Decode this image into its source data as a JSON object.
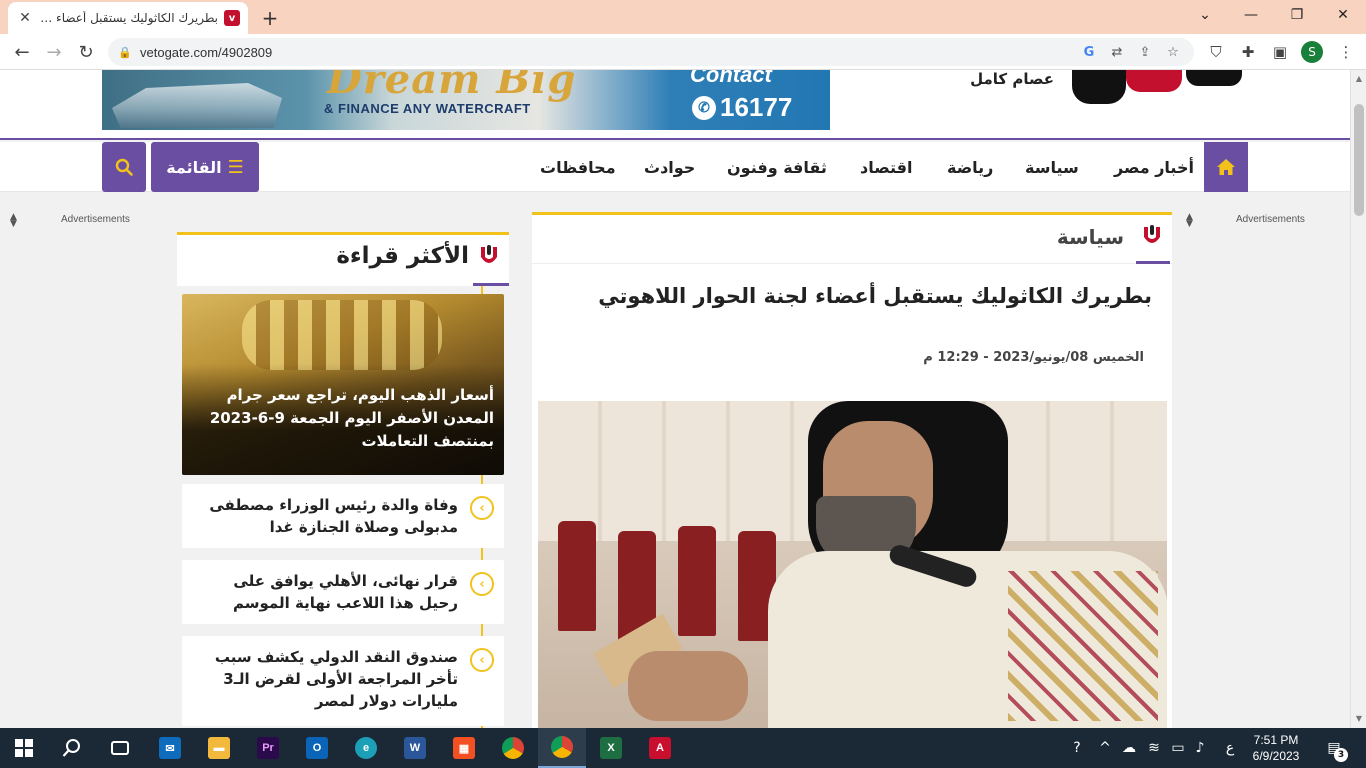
{
  "browser": {
    "tab_title": "بطريرك الكاثوليك يستقبل أعضاء لجنة الحوار اللاهوتي",
    "url": "vetogate.com/4902809",
    "profile_initial": "S"
  },
  "banner": {
    "headline": "Dream Big",
    "subline": "& FINANCE ANY WATERCRAFT",
    "contact": "Contact",
    "phone": "16177"
  },
  "header": {
    "author": "عصام كامل"
  },
  "nav": {
    "items": [
      "أخبار مصر",
      "سياسة",
      "رياضة",
      "اقتصاد",
      "ثقافة وفنون",
      "حوادث",
      "محافظات"
    ],
    "menu_label": "القائمة"
  },
  "ads": {
    "label": "Advertisements"
  },
  "most_read": {
    "title": "الأكثر قراءة",
    "feature": "أسعار الذهب اليوم، تراجع سعر جرام المعدن الأصفر اليوم الجمعة 9-6-2023 بمنتصف التعاملات",
    "items": [
      "وفاة والدة رئيس الوزراء مصطفى مدبولى وصلاة الجنازة غدا",
      "قرار نهائى، الأهلي يوافق على رحيل هذا اللاعب نهاية الموسم",
      "صندوق النقد الدولي يكشف سبب تأخر المراجعة الأولى لقرض الـ3 مليارات دولار لمصر"
    ]
  },
  "article": {
    "category": "سياسة",
    "title": "بطريرك الكاثوليك يستقبل أعضاء لجنة الحوار اللاهوتي",
    "date": "الخميس 08/يونيو/2023 - 12:29 م"
  },
  "taskbar": {
    "time": "7:51 PM",
    "date": "6/9/2023",
    "lang": "ع",
    "notifications": "3"
  },
  "colors": {
    "brand_purple": "#6a4ea1",
    "accent_yellow": "#f2c21b",
    "brand_red": "#c3102f"
  }
}
